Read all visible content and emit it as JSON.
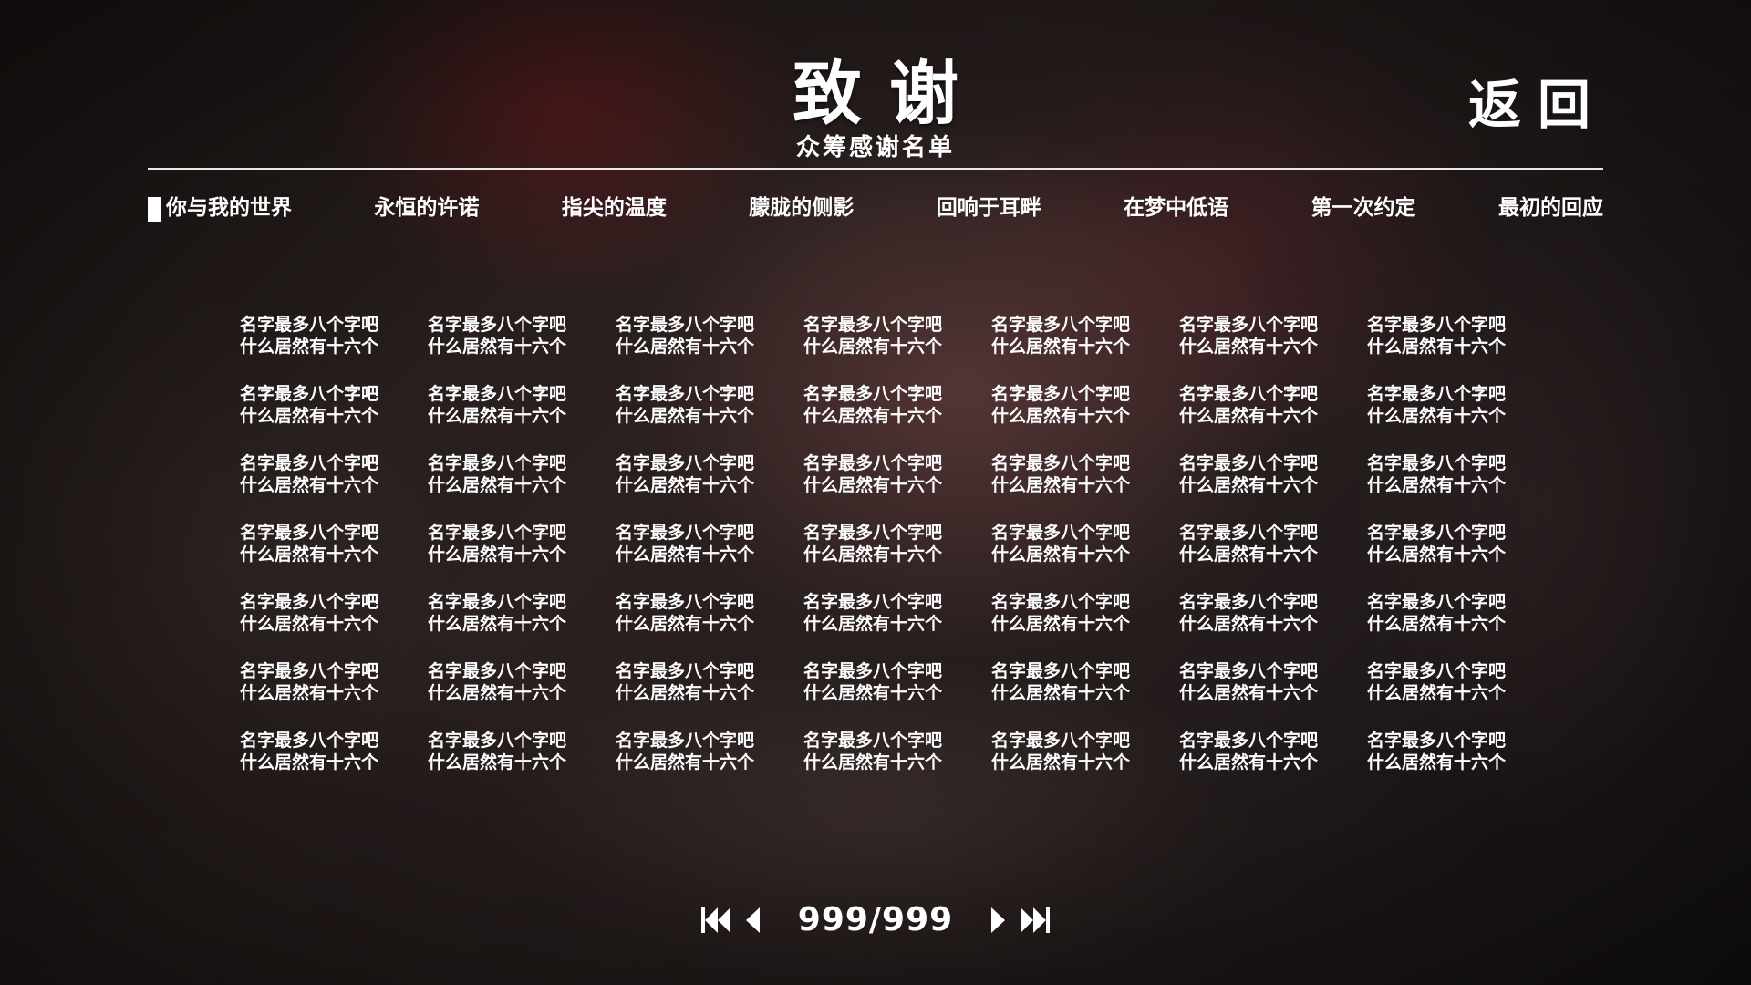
{
  "header": {
    "title": "致谢",
    "subtitle": "众筹感谢名单",
    "back_label": "返回"
  },
  "tabs": [
    {
      "label": "你与我的世界",
      "active": true
    },
    {
      "label": "永恒的许诺",
      "active": false
    },
    {
      "label": "指尖的温度",
      "active": false
    },
    {
      "label": "朦胧的侧影",
      "active": false
    },
    {
      "label": "回响于耳畔",
      "active": false
    },
    {
      "label": "在梦中低语",
      "active": false
    },
    {
      "label": "第一次约定",
      "active": false
    },
    {
      "label": "最初的回应",
      "active": false
    }
  ],
  "names": {
    "rows": 7,
    "columns": 7,
    "entries": [
      [
        "名字最多八个字吧",
        "什么居然有十六个"
      ],
      [
        "名字最多八个字吧",
        "什么居然有十六个"
      ],
      [
        "名字最多八个字吧",
        "什么居然有十六个"
      ],
      [
        "名字最多八个字吧",
        "什么居然有十六个"
      ],
      [
        "名字最多八个字吧",
        "什么居然有十六个"
      ],
      [
        "名字最多八个字吧",
        "什么居然有十六个"
      ],
      [
        "名字最多八个字吧",
        "什么居然有十六个"
      ],
      [
        "名字最多八个字吧",
        "什么居然有十六个"
      ],
      [
        "名字最多八个字吧",
        "什么居然有十六个"
      ],
      [
        "名字最多八个字吧",
        "什么居然有十六个"
      ],
      [
        "名字最多八个字吧",
        "什么居然有十六个"
      ],
      [
        "名字最多八个字吧",
        "什么居然有十六个"
      ],
      [
        "名字最多八个字吧",
        "什么居然有十六个"
      ],
      [
        "名字最多八个字吧",
        "什么居然有十六个"
      ],
      [
        "名字最多八个字吧",
        "什么居然有十六个"
      ],
      [
        "名字最多八个字吧",
        "什么居然有十六个"
      ],
      [
        "名字最多八个字吧",
        "什么居然有十六个"
      ],
      [
        "名字最多八个字吧",
        "什么居然有十六个"
      ],
      [
        "名字最多八个字吧",
        "什么居然有十六个"
      ],
      [
        "名字最多八个字吧",
        "什么居然有十六个"
      ],
      [
        "名字最多八个字吧",
        "什么居然有十六个"
      ],
      [
        "名字最多八个字吧",
        "什么居然有十六个"
      ],
      [
        "名字最多八个字吧",
        "什么居然有十六个"
      ],
      [
        "名字最多八个字吧",
        "什么居然有十六个"
      ],
      [
        "名字最多八个字吧",
        "什么居然有十六个"
      ],
      [
        "名字最多八个字吧",
        "什么居然有十六个"
      ],
      [
        "名字最多八个字吧",
        "什么居然有十六个"
      ],
      [
        "名字最多八个字吧",
        "什么居然有十六个"
      ],
      [
        "名字最多八个字吧",
        "什么居然有十六个"
      ],
      [
        "名字最多八个字吧",
        "什么居然有十六个"
      ],
      [
        "名字最多八个字吧",
        "什么居然有十六个"
      ],
      [
        "名字最多八个字吧",
        "什么居然有十六个"
      ],
      [
        "名字最多八个字吧",
        "什么居然有十六个"
      ],
      [
        "名字最多八个字吧",
        "什么居然有十六个"
      ],
      [
        "名字最多八个字吧",
        "什么居然有十六个"
      ],
      [
        "名字最多八个字吧",
        "什么居然有十六个"
      ],
      [
        "名字最多八个字吧",
        "什么居然有十六个"
      ],
      [
        "名字最多八个字吧",
        "什么居然有十六个"
      ],
      [
        "名字最多八个字吧",
        "什么居然有十六个"
      ],
      [
        "名字最多八个字吧",
        "什么居然有十六个"
      ],
      [
        "名字最多八个字吧",
        "什么居然有十六个"
      ],
      [
        "名字最多八个字吧",
        "什么居然有十六个"
      ],
      [
        "名字最多八个字吧",
        "什么居然有十六个"
      ],
      [
        "名字最多八个字吧",
        "什么居然有十六个"
      ],
      [
        "名字最多八个字吧",
        "什么居然有十六个"
      ],
      [
        "名字最多八个字吧",
        "什么居然有十六个"
      ],
      [
        "名字最多八个字吧",
        "什么居然有十六个"
      ],
      [
        "名字最多八个字吧",
        "什么居然有十六个"
      ],
      [
        "名字最多八个字吧",
        "什么居然有十六个"
      ]
    ]
  },
  "pager": {
    "indicator": "999/999",
    "first_icon": "skip-to-first-icon",
    "prev_icon": "previous-page-icon",
    "next_icon": "next-page-icon",
    "last_icon": "skip-to-last-icon"
  },
  "colors": {
    "text": "#ffffff",
    "rule": "#e8e8e8"
  }
}
